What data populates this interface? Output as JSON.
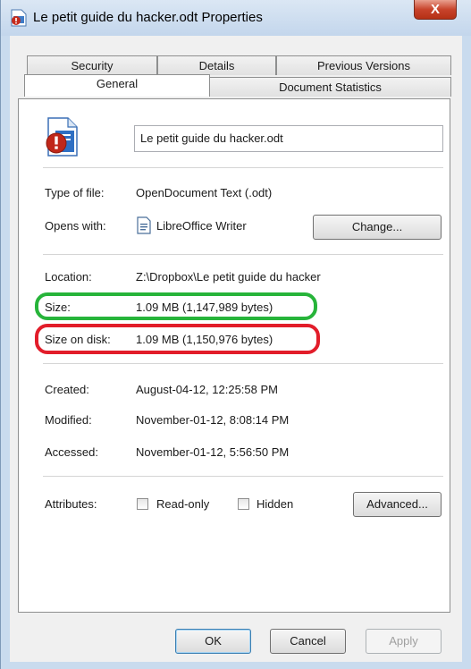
{
  "window": {
    "title": "Le petit guide du hacker.odt Properties",
    "close_label": "X"
  },
  "tabs": {
    "row_back": [
      "Security",
      "Details",
      "Previous Versions"
    ],
    "row_front": [
      "General",
      "Document Statistics"
    ],
    "active": "General"
  },
  "general": {
    "file_name": "Le petit guide du hacker.odt",
    "type_label": "Type of file:",
    "type_value": "OpenDocument Text (.odt)",
    "opens_label": "Opens with:",
    "opens_value": "LibreOffice Writer",
    "change_button": "Change...",
    "location_label": "Location:",
    "location_value": "Z:\\Dropbox\\Le petit guide du hacker",
    "size_label": "Size:",
    "size_value": "1.09 MB (1,147,989 bytes)",
    "size_on_disk_label": "Size on disk:",
    "size_on_disk_value": "1.09 MB (1,150,976 bytes)",
    "created_label": "Created:",
    "created_value": "August-04-12, 12:25:58 PM",
    "modified_label": "Modified:",
    "modified_value": "November-01-12, 8:08:14 PM",
    "accessed_label": "Accessed:",
    "accessed_value": "November-01-12, 5:56:50 PM",
    "attributes_label": "Attributes:",
    "readonly_label": "Read-only",
    "hidden_label": "Hidden",
    "advanced_button": "Advanced..."
  },
  "footer": {
    "ok": "OK",
    "cancel": "Cancel",
    "apply": "Apply"
  },
  "colors": {
    "highlight_green": "#27b43a",
    "highlight_red": "#e21d2a"
  }
}
